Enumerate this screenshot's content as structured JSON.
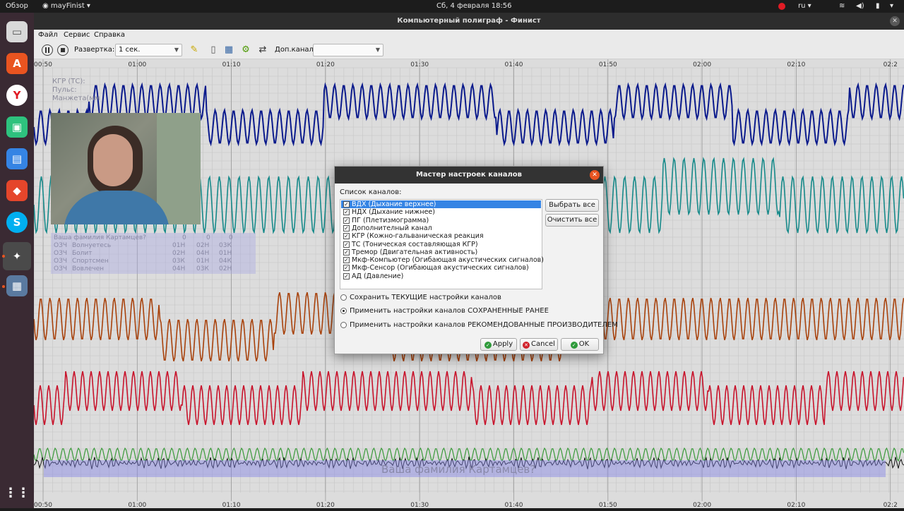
{
  "topbar": {
    "overview": "Обзор",
    "app_menu": "mayFinist",
    "datetime": "Сб, 4 февраля  18:56",
    "lang": "ru"
  },
  "window": {
    "title": "Компьютерный полиграф - Финист",
    "close": "✕"
  },
  "menu": {
    "file": "Файл",
    "service": "Сервис",
    "help": "Справка"
  },
  "toolbar": {
    "sweep_label": "Развертка:",
    "sweep_value": "1 сек.",
    "extra_channel_label": "Доп.канал:",
    "extra_channel_value": ""
  },
  "time_axis": [
    "00:50",
    "01:00",
    "01:10",
    "01:20",
    "01:30",
    "01:40",
    "01:50",
    "02:00",
    "02:10",
    "02:2"
  ],
  "overlay": {
    "channels": [
      "КГР (ТС):",
      "Пульс:",
      "Манжета(мм"
    ],
    "question_header": [
      "Ваша фамилия Картамцев?",
      "0",
      "0",
      "0"
    ],
    "rows": [
      [
        "ОЗЧ",
        "Волнуетесь",
        "01Н",
        "02Н",
        "03К"
      ],
      [
        "ОЗЧ",
        "Болит",
        "02Н",
        "04Н",
        "01Н"
      ],
      [
        "ОЗЧ",
        "Спортсмен",
        "03К",
        "01Н",
        "04К"
      ],
      [
        "ОЗЧ",
        "Вовлечен",
        "04Н",
        "03К",
        "02Н"
      ]
    ],
    "current_question": "Ваша фамилия Картамцев?"
  },
  "dialog": {
    "title": "Мастер настроек каналов",
    "list_label": "Список каналов:",
    "channels": [
      "ВДХ (Дыхание верхнее)",
      "НДХ (Дыхание нижнее)",
      "ПГ (Плетизмограмма)",
      "Дополнителный канал",
      "КГР (Кожно-гальваническая реакция",
      "ТС (Тоническая составляющая КГР)",
      "Тремор (Двигательная активность)",
      "Мкф-Компьютер (Огибающая акустических сигналов)",
      "Мкф-Сенсор (Огибающая акустических сигналов)",
      "АД (Давление)"
    ],
    "select_all": "Выбрать все",
    "clear_all": "Очистить все",
    "options": [
      "Сохранить ТЕКУЩИЕ настройки каналов",
      "Применить настройки каналов СОХРАНЕННЫЕ РАНЕЕ",
      "Применить настройки каналов РЕКОМЕНДОВАННЫЕ ПРОИЗВОДИТЕЛЕМ"
    ],
    "selected_option": 1,
    "apply": "Apply",
    "cancel": "Cancel",
    "ok": "OK"
  },
  "colors": {
    "ch1": "#0a1a8c",
    "ch2": "#178a8a",
    "ch3": "#a8420c",
    "ch4": "#c8142c",
    "ch5": "#3a9a3a",
    "accent": "#e95420",
    "selection": "#3584e4"
  }
}
